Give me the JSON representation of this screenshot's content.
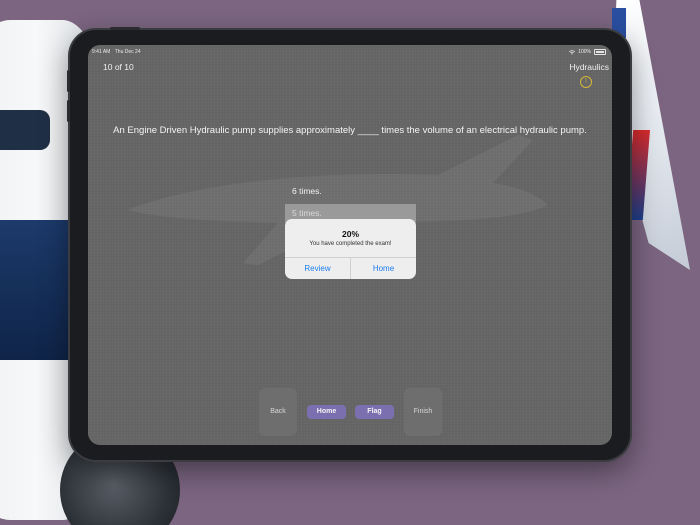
{
  "status_bar": {
    "time": "9:41 AM",
    "date": "Thu Dec 24",
    "battery": "100%"
  },
  "exam": {
    "counter": "10 of 10",
    "category": "Hydraulics",
    "question": "An Engine Driven Hydraulic pump supplies approximately ____ times the volume of an electrical hydraulic pump.",
    "answers": [
      {
        "label": "6 times.",
        "selected": false
      },
      {
        "label": "5 times.",
        "selected": true
      }
    ]
  },
  "alert": {
    "title": "20%",
    "message": "You have completed the exam!",
    "review_label": "Review",
    "home_label": "Home"
  },
  "toolbar": {
    "back_label": "Back",
    "home_label": "Home",
    "flag_label": "Flag",
    "finish_label": "Finish"
  },
  "colors": {
    "accent_purple": "#7b6fb0",
    "alert_link_blue": "#1c7cf2",
    "info_yellow": "#d7b73a",
    "screen_gray": "#646464"
  },
  "icons": {
    "info": "info-circle-icon",
    "wifi": "wifi-icon",
    "battery": "battery-icon"
  }
}
